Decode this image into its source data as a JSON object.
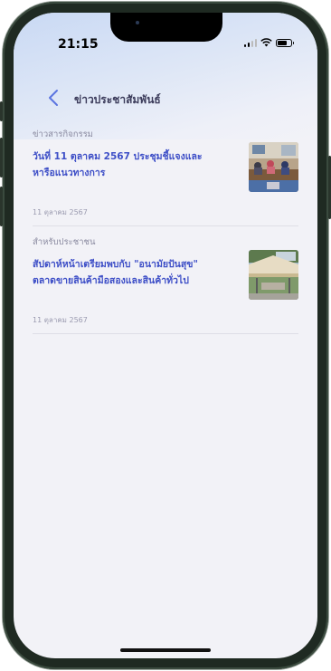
{
  "status": {
    "time": "21:15"
  },
  "nav": {
    "title": "ข่าวประชาสัมพันธ์"
  },
  "news": [
    {
      "category": "ข่าวสารกิจกรรม",
      "title": "วันที่ 11 ตุลาคม 2567 ประชุมชี้แจงและหารือแนวทางการ",
      "date": "11 ตุลาคม 2567",
      "icon": "meeting-room-photo"
    },
    {
      "category": "สำหรับประชาชน",
      "title": "สัปดาห์หน้าเตรียมพบกับ \"อนามัยปันสุข\" ตลาดขายสินค้ามือสองและสินค้าทั่วไป",
      "date": "11 ตุลาคม 2567",
      "icon": "outdoor-market-tent-photo"
    }
  ],
  "colors": {
    "accent": "#3e4fc7",
    "background": "#f2f2f7"
  }
}
